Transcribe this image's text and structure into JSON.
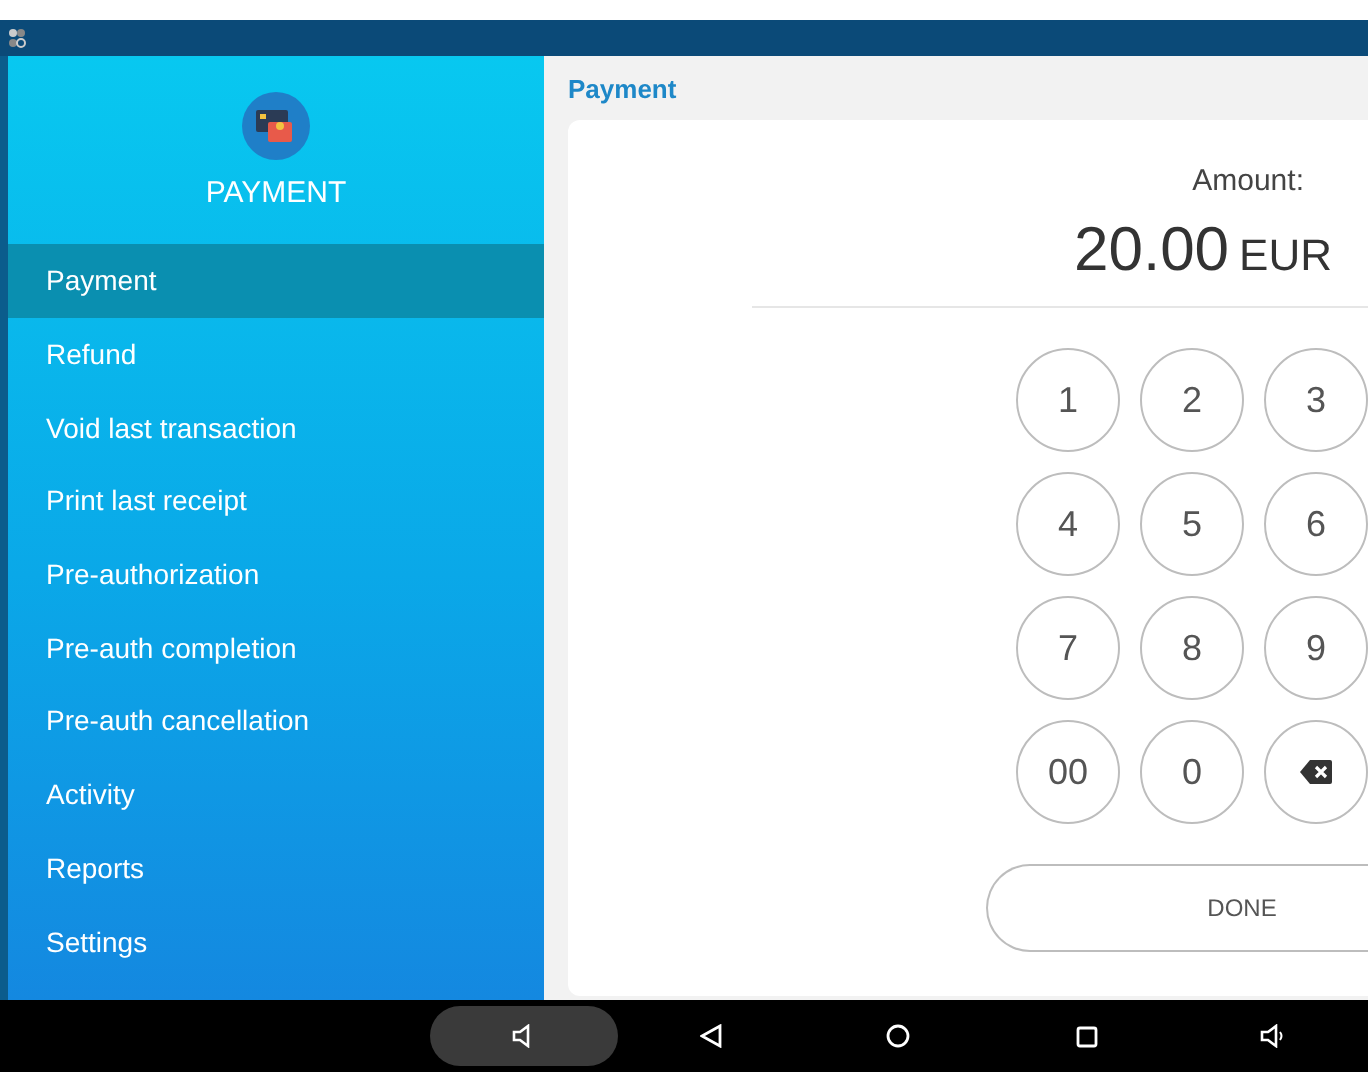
{
  "sidebar": {
    "title": "PAYMENT",
    "items": [
      {
        "label": "Payment",
        "selected": true
      },
      {
        "label": "Refund",
        "selected": false
      },
      {
        "label": "Void last transaction",
        "selected": false
      },
      {
        "label": "Print last receipt",
        "selected": false
      },
      {
        "label": "Pre-authorization",
        "selected": false
      },
      {
        "label": "Pre-auth completion",
        "selected": false
      },
      {
        "label": "Pre-auth cancellation",
        "selected": false
      },
      {
        "label": "Activity",
        "selected": false
      },
      {
        "label": "Reports",
        "selected": false
      },
      {
        "label": "Settings",
        "selected": false
      }
    ]
  },
  "content": {
    "title": "Payment",
    "amount_label": "Amount:",
    "amount": "20.00",
    "currency": "EUR",
    "keys": [
      {
        "kind": "digit",
        "label": "1"
      },
      {
        "kind": "digit",
        "label": "2"
      },
      {
        "kind": "digit",
        "label": "3"
      },
      {
        "kind": "digit",
        "label": "4"
      },
      {
        "kind": "digit",
        "label": "5"
      },
      {
        "kind": "digit",
        "label": "6"
      },
      {
        "kind": "digit",
        "label": "7"
      },
      {
        "kind": "digit",
        "label": "8"
      },
      {
        "kind": "digit",
        "label": "9"
      },
      {
        "kind": "digit",
        "label": "00"
      },
      {
        "kind": "digit",
        "label": "0"
      },
      {
        "kind": "backspace"
      }
    ],
    "done": "DONE"
  }
}
